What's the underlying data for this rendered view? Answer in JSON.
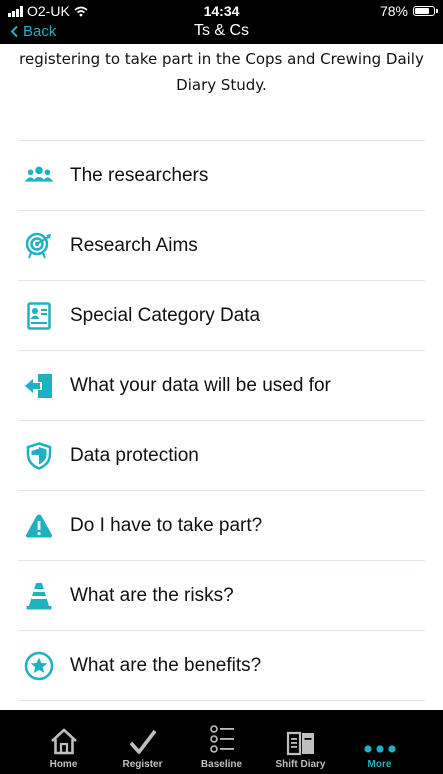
{
  "status_bar": {
    "carrier": "O2-UK",
    "time": "14:34",
    "battery": "78%",
    "battery_level": 0.78
  },
  "nav": {
    "back_label": "Back",
    "title": "Ts & Cs"
  },
  "intro_text": "registering to take part in the Cops and Crewing Daily Diary Study.",
  "items": [
    {
      "label": "The researchers",
      "icon": "people-icon"
    },
    {
      "label": "Research Aims",
      "icon": "target-icon"
    },
    {
      "label": "Special Category Data",
      "icon": "id-card-icon"
    },
    {
      "label": "What your data will be used for",
      "icon": "exit-door-icon"
    },
    {
      "label": "Data protection",
      "icon": "shield-icon"
    },
    {
      "label": "Do I have to take part?",
      "icon": "warning-icon"
    },
    {
      "label": "What are the risks?",
      "icon": "traffic-cone-icon"
    },
    {
      "label": "What are the benefits?",
      "icon": "star-circle-icon"
    }
  ],
  "tabs": [
    {
      "label": "Home",
      "icon": "home-icon",
      "active": false
    },
    {
      "label": "Register",
      "icon": "checkmark-icon",
      "active": false
    },
    {
      "label": "Baseline",
      "icon": "list-icon",
      "active": false
    },
    {
      "label": "Shift Diary",
      "icon": "book-icon",
      "active": false
    },
    {
      "label": "More",
      "icon": "more-dots-icon",
      "active": true
    }
  ],
  "colors": {
    "accent": "#1fb0c2",
    "bar_background": "#000000",
    "divider": "#d7e7ea",
    "tab_inactive": "#bfbfbf"
  }
}
